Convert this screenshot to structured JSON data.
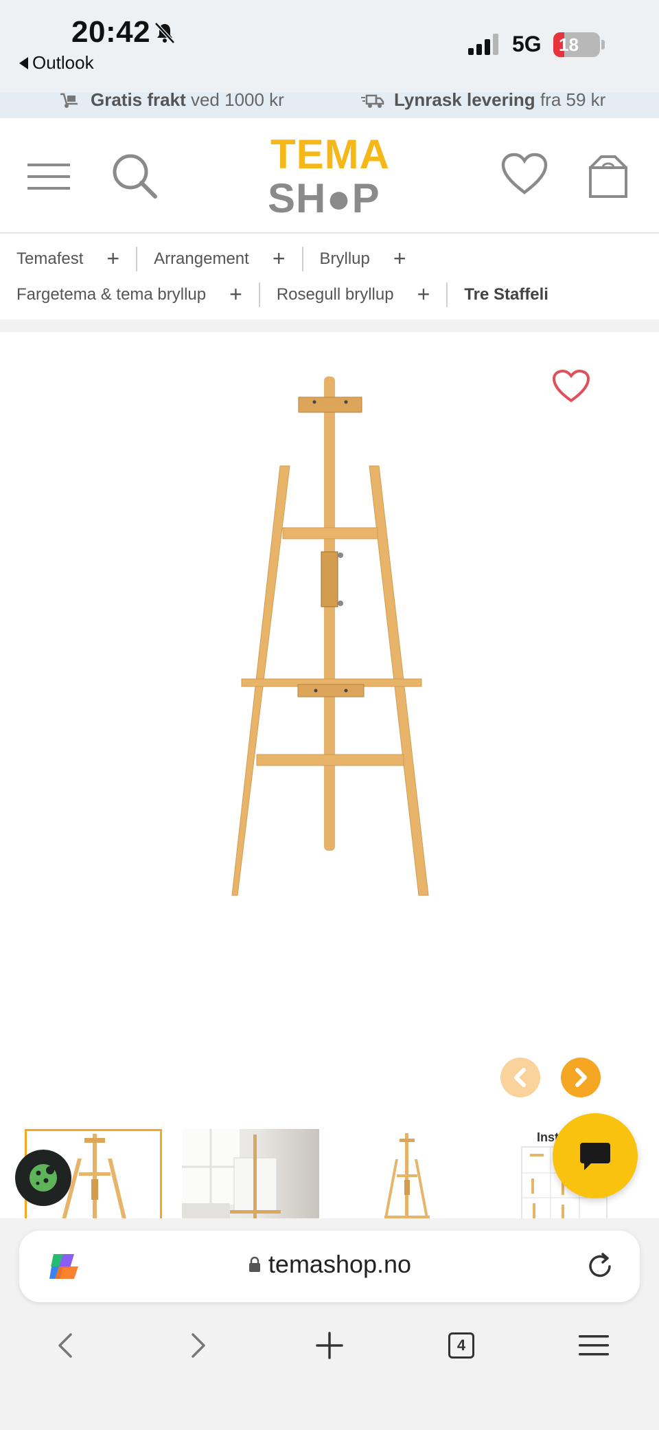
{
  "status_bar": {
    "time": "20:42",
    "back_app": "Outlook",
    "network": "5G",
    "battery": "18",
    "battery_level": 0.18
  },
  "promo": {
    "shipping_bold": "Gratis frakt",
    "shipping_rest": "ved 1000 kr",
    "delivery_bold": "Lynrask levering",
    "delivery_rest": "fra 59 kr"
  },
  "header": {
    "logo_top": "TEMA",
    "logo_bottom": "SH●P"
  },
  "breadcrumb": {
    "items": [
      {
        "label": "Temafest"
      },
      {
        "label": "Arrangement"
      },
      {
        "label": "Bryllup"
      },
      {
        "label": "Fargetema & tema bryllup"
      },
      {
        "label": "Rosegull bryllup"
      }
    ],
    "current": "Tre Staffeli"
  },
  "gallery": {
    "thumb_4_label": "Inst"
  },
  "browser": {
    "url": "temashop.no",
    "tab_count": "4"
  },
  "colors": {
    "accent": "#f5a623",
    "logo_yellow": "#f6b718",
    "chat_yellow": "#f8c20f",
    "heart_red": "#e0505a",
    "wood": "#e8b46a"
  }
}
